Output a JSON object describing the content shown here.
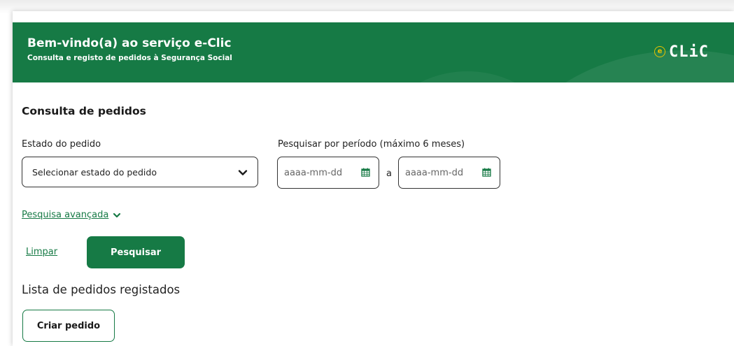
{
  "banner": {
    "title": "Bem-vindo(a) ao serviço e-Clic",
    "subtitle": "Consulta e registo de pedidos à Segurança Social",
    "logo_e": "e",
    "logo_text": "CLiC",
    "color": "#167a45"
  },
  "search": {
    "section_title": "Consulta de pedidos",
    "status_label": "Estado do pedido",
    "status_placeholder": "Selecionar estado do pedido",
    "period_label": "Pesquisar por período (máximo 6 meses)",
    "date_from_placeholder": "aaaa-mm-dd",
    "date_to_placeholder": "aaaa-mm-dd",
    "date_separator": "a",
    "advanced_search": "Pesquisa avançada",
    "clear_label": "Limpar",
    "search_label": "Pesquisar"
  },
  "list": {
    "title": "Lista de pedidos registados",
    "create_label": "Criar pedido"
  },
  "icons": {
    "dropdown": "chevron-down-icon",
    "date": "calendar-icon",
    "advanced": "chevron-down-icon"
  }
}
